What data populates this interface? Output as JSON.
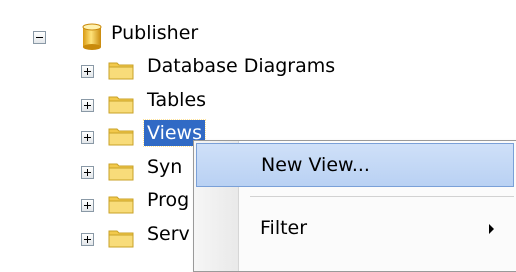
{
  "tree": {
    "root": {
      "label": "Publisher",
      "icon": "database-icon",
      "expanded": true
    },
    "children": [
      {
        "label": "Database Diagrams",
        "icon": "folder-icon",
        "expanded": false
      },
      {
        "label": "Tables",
        "icon": "folder-icon",
        "expanded": false
      },
      {
        "label": "Views",
        "icon": "folder-icon",
        "expanded": false,
        "selected": true
      },
      {
        "label": "Syn",
        "icon": "folder-icon",
        "expanded": false
      },
      {
        "label": "Prog",
        "icon": "folder-icon",
        "expanded": false
      },
      {
        "label": "Serv",
        "icon": "folder-icon",
        "expanded": false
      }
    ]
  },
  "context_menu": {
    "items": [
      {
        "label": "New View...",
        "hovered": true
      },
      {
        "label": "Filter",
        "has_submenu": true
      }
    ]
  },
  "colors": {
    "selection": "#316ac5",
    "menu_hover": "#c3d7f5",
    "folder": "#f5d36a"
  }
}
